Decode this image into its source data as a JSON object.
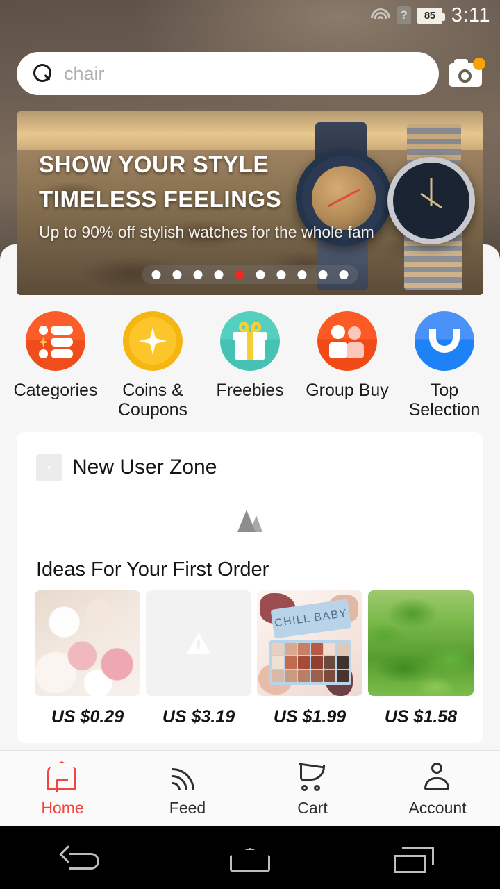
{
  "status_bar": {
    "wifi_icon": "wifi-icon",
    "sim_icon": "question-sim-icon",
    "sim_label": "?",
    "battery_level": "85",
    "time": "3:11"
  },
  "search": {
    "icon": "search-icon",
    "placeholder": "chair",
    "camera_icon": "camera-icon",
    "camera_badge": "new-badge-dot"
  },
  "banner": {
    "line1": "SHOW YOUR STYLE",
    "line2": "TIMELESS FEELINGS",
    "line3": "Up to 90% off stylish watches for the whole fam",
    "dot_count": 10,
    "active_dot": 5,
    "active_dot_color": "#ee2b20"
  },
  "quick_links": [
    {
      "label": "Categories",
      "icon": "list-sparkle-icon",
      "color": "#fb5d2a"
    },
    {
      "label": "Coins & Coupons",
      "icon": "coin-star-icon",
      "color": "#f5b612"
    },
    {
      "label": "Freebies",
      "icon": "gift-box-icon",
      "color": "#54cfc0"
    },
    {
      "label": "Group Buy",
      "icon": "two-people-icon",
      "color": "#fb5a25"
    },
    {
      "label": "Top Selection",
      "icon": "smile-icon",
      "color": "#1c82f5"
    }
  ],
  "new_user_zone": {
    "title": "New User Zone",
    "header_icon": "image-placeholder-icon",
    "broken_image_icon": "broken-image-icon",
    "ideas_title": "Ideas For Your First Order",
    "products": [
      {
        "price": "US $0.29",
        "image": "balloons-image"
      },
      {
        "price": "US $3.19",
        "image": "failed-image-placeholder"
      },
      {
        "price": "US $1.99",
        "image": "chill-baby-eyeshadow-palette-image",
        "image_text": "CHILL BABY"
      },
      {
        "price": "US $1.58",
        "image": "aquarium-moss-image"
      }
    ]
  },
  "bottom_nav": {
    "active": "Home",
    "active_color": "#f2453d",
    "items": [
      {
        "label": "Home",
        "icon": "house-icon"
      },
      {
        "label": "Feed",
        "icon": "feed-signal-icon"
      },
      {
        "label": "Cart",
        "icon": "shopping-cart-icon"
      },
      {
        "label": "Account",
        "icon": "person-icon"
      }
    ]
  },
  "system_nav": {
    "items": [
      {
        "name": "back",
        "icon": "back-arrow-icon"
      },
      {
        "name": "home",
        "icon": "home-pentagon-icon"
      },
      {
        "name": "recents",
        "icon": "recents-squares-icon"
      }
    ]
  }
}
